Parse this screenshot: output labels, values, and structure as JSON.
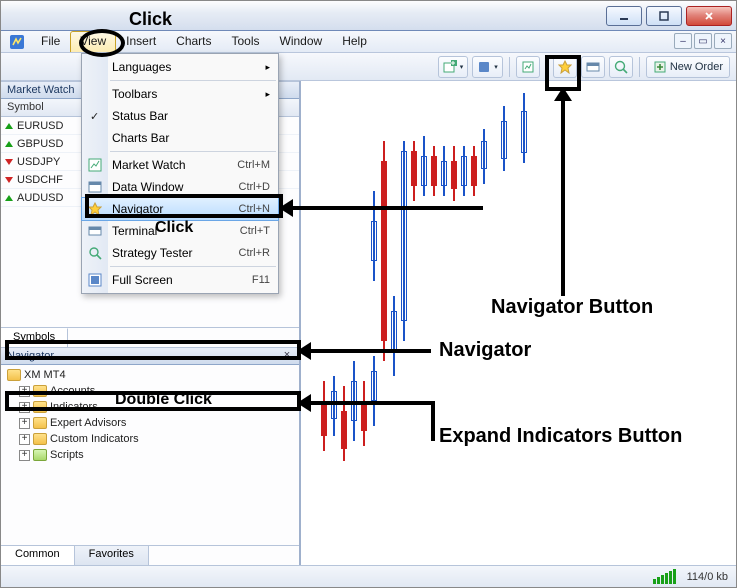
{
  "menubar": {
    "items": [
      "File",
      "View",
      "Insert",
      "Charts",
      "Tools",
      "Window",
      "Help"
    ]
  },
  "toolbar": {
    "new_order": "New Order"
  },
  "market_watch": {
    "title": "Market Watch",
    "col_header": "Symbol",
    "rows": [
      {
        "symbol": "EURUSD",
        "dir": "up"
      },
      {
        "symbol": "GBPUSD",
        "dir": "up"
      },
      {
        "symbol": "USDJPY",
        "dir": "dn"
      },
      {
        "symbol": "USDCHF",
        "dir": "dn"
      },
      {
        "symbol": "AUDUSD",
        "dir": "up"
      }
    ],
    "tab": "Symbols"
  },
  "navigator": {
    "title": "Navigator",
    "root": "XM MT4",
    "items": [
      "Accounts",
      "Indicators",
      "Expert Advisors",
      "Custom Indicators",
      "Scripts"
    ],
    "tabs": [
      "Common",
      "Favorites"
    ]
  },
  "view_menu": {
    "items": [
      {
        "label": "Languages",
        "sub": true
      },
      {
        "label": "Toolbars",
        "sub": true
      },
      {
        "label": "Status Bar",
        "check": true
      },
      {
        "label": "Charts Bar",
        "check": false
      },
      {
        "label": "Market Watch",
        "shortcut": "Ctrl+M",
        "icon": "mw"
      },
      {
        "label": "Data Window",
        "shortcut": "Ctrl+D",
        "icon": "dw"
      },
      {
        "label": "Navigator",
        "shortcut": "Ctrl+N",
        "icon": "nav",
        "hl": true
      },
      {
        "label": "Terminal",
        "shortcut": "Ctrl+T",
        "icon": "term"
      },
      {
        "label": "Strategy Tester",
        "shortcut": "Ctrl+R",
        "icon": "st"
      },
      {
        "label": "Full Screen",
        "shortcut": "F11",
        "icon": "fs"
      }
    ]
  },
  "status": {
    "conn": "114/0 kb"
  },
  "annotations": {
    "click1": "Click",
    "click2": "Click",
    "dbl": "Double Click",
    "nav_btn": "Navigator Button",
    "nav": "Navigator",
    "expand": "Expand Indicators Button"
  }
}
